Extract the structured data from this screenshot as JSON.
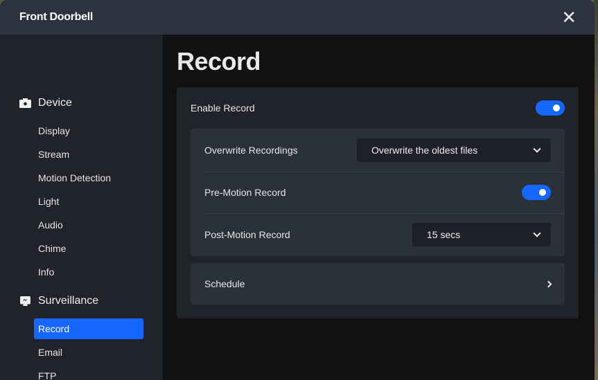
{
  "dialog": {
    "title": "Front Doorbell",
    "close_label": "✕"
  },
  "sidebar": {
    "sections": [
      {
        "label": "Device",
        "icon": "camera-icon",
        "items": [
          "Display",
          "Stream",
          "Motion Detection",
          "Light",
          "Audio",
          "Chime",
          "Info"
        ]
      },
      {
        "label": "Surveillance",
        "icon": "monitor-icon",
        "items": [
          "Record",
          "Email",
          "FTP"
        ]
      }
    ],
    "active_item": "Record"
  },
  "main": {
    "title": "Record",
    "enable_record": {
      "label": "Enable Record",
      "on": true
    },
    "overwrite": {
      "label": "Overwrite Recordings",
      "value": "Overwrite the oldest files"
    },
    "pre_motion": {
      "label": "Pre-Motion Record",
      "on": true
    },
    "post_motion": {
      "label": "Post-Motion Record",
      "value": "15 secs"
    },
    "schedule": {
      "label": "Schedule"
    }
  },
  "colors": {
    "accent": "#1567ff",
    "header": "#2d333e",
    "sidebar": "#21232a"
  }
}
